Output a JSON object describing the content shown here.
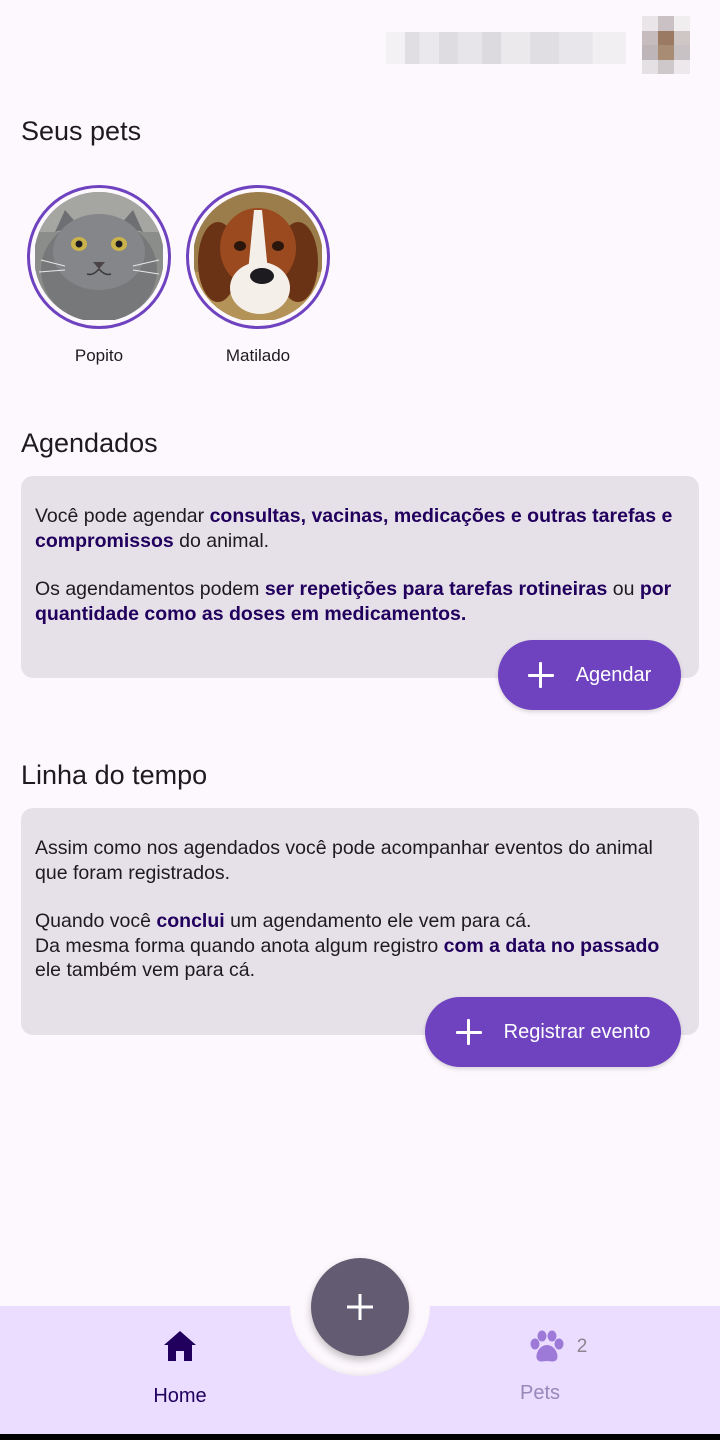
{
  "header": {
    "user_avatar_icon": "user-avatar-icon"
  },
  "pets_section": {
    "title": "Seus pets",
    "pets": [
      {
        "name": "Popito",
        "photo": "gray-cat-photo"
      },
      {
        "name": "Matilado",
        "photo": "beagle-dog-photo"
      }
    ]
  },
  "scheduled_section": {
    "title": "Agendados",
    "p1_a": "Você pode agendar ",
    "p1_b": "consultas, vacinas, medicações e outras tarefas e compromissos",
    "p1_c": " do animal.",
    "p2_a": "Os agendamentos podem ",
    "p2_b": "ser repetições para tarefas rotineiras",
    "p2_c": " ou ",
    "p2_d": "por quantidade como as doses em medicamentos.",
    "button_label": "Agendar"
  },
  "timeline_section": {
    "title": "Linha do tempo",
    "p1": "Assim como nos agendados você pode acompanhar eventos do animal que foram registrados.",
    "p2_a": "Quando você ",
    "p2_b": "conclui",
    "p2_c": " um agendamento ele vem para cá.",
    "p3_a": "Da mesma forma quando anota algum registro ",
    "p3_b": "com a data no passado",
    "p3_c": " ele também vem para cá.",
    "button_label": "Registrar evento"
  },
  "bottom_nav": {
    "home_label": "Home",
    "pets_label": "Pets",
    "pets_count": "2"
  },
  "colors": {
    "primary": "#6f43c0",
    "card_bg": "#e6e0e9",
    "emphasis_text": "#21005d",
    "nav_bg": "#eaddff",
    "fab_bg": "#625b71"
  }
}
